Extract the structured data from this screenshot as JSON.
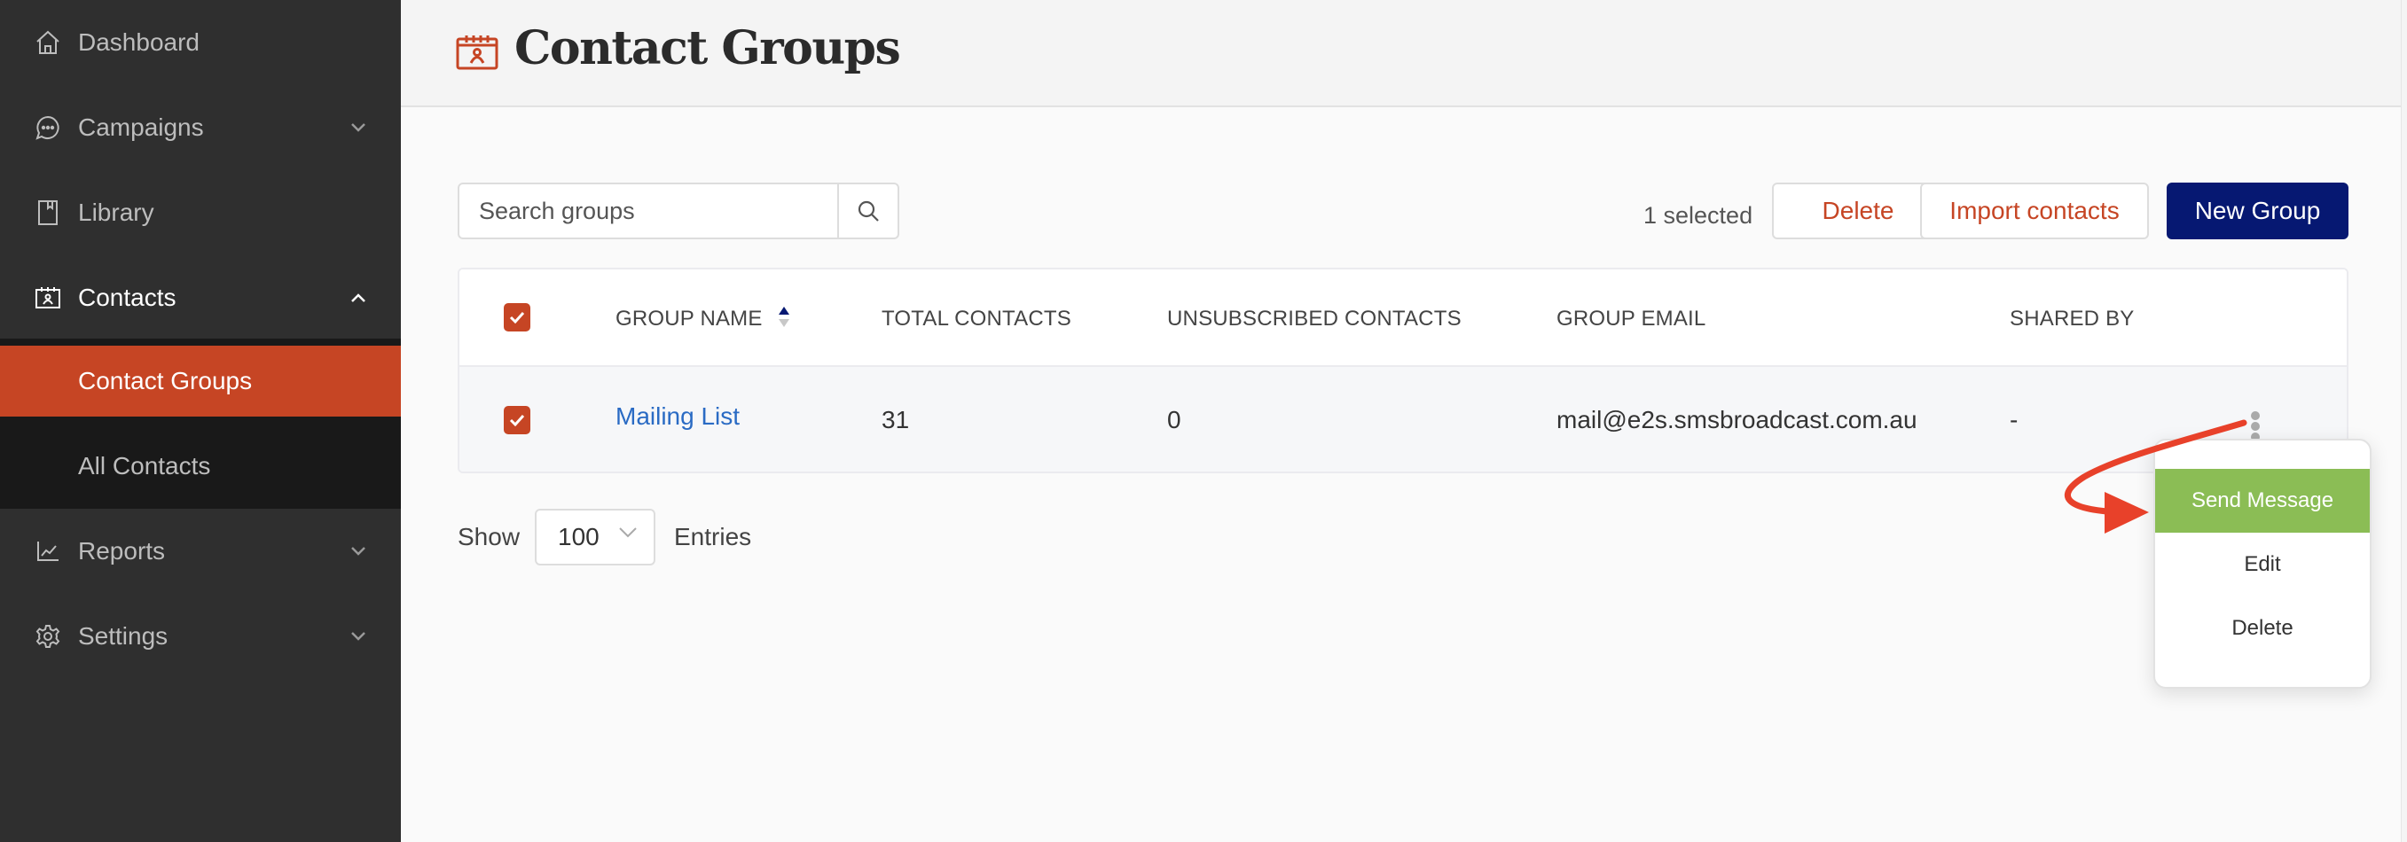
{
  "sidebar": {
    "items": [
      {
        "label": "Dashboard",
        "icon": "home-icon"
      },
      {
        "label": "Campaigns",
        "icon": "chat-bubble-icon",
        "expandable": true,
        "expanded": false
      },
      {
        "label": "Library",
        "icon": "book-icon"
      },
      {
        "label": "Contacts",
        "icon": "contact-card-icon",
        "expandable": true,
        "expanded": true,
        "children": [
          {
            "label": "Contact Groups",
            "active": true
          },
          {
            "label": "All Contacts",
            "active": false
          }
        ]
      },
      {
        "label": "Reports",
        "icon": "line-chart-icon",
        "expandable": true,
        "expanded": false
      },
      {
        "label": "Settings",
        "icon": "gear-icon",
        "expandable": true,
        "expanded": false
      }
    ]
  },
  "header": {
    "title": "Contact Groups",
    "icon": "contact-card-icon"
  },
  "toolbar": {
    "search_placeholder": "Search groups",
    "search_value": "",
    "selected_count": "1 selected",
    "delete_label": "Delete",
    "import_label": "Import contacts",
    "new_group_label": "New Group"
  },
  "table": {
    "columns": [
      "GROUP NAME",
      "TOTAL CONTACTS",
      "UNSUBSCRIBED CONTACTS",
      "GROUP EMAIL",
      "SHARED BY"
    ],
    "sort": {
      "column": "GROUP NAME",
      "direction": "ascending"
    },
    "select_all_checked": true,
    "rows": [
      {
        "checked": true,
        "group_name": "Mailing List",
        "total_contacts": "31",
        "unsubscribed_contacts": "0",
        "group_email": "mail@e2s.smsbroadcast.com.au",
        "shared_by": "-"
      }
    ]
  },
  "pagination": {
    "show_label": "Show",
    "entries_value": "100",
    "entries_label": "Entries"
  },
  "row_menu": {
    "items": [
      {
        "label": "Send Message",
        "highlighted": true
      },
      {
        "label": "Edit",
        "highlighted": false
      },
      {
        "label": "Delete",
        "highlighted": false
      }
    ]
  },
  "colors": {
    "accent": "#c64524",
    "primary_button": "#061872",
    "link": "#2a6bc4",
    "menu_highlight": "#8bbd55",
    "annotation_arrow": "#e8412a",
    "sidebar_bg": "#2f2f2f",
    "subnav_bg": "#191919"
  }
}
